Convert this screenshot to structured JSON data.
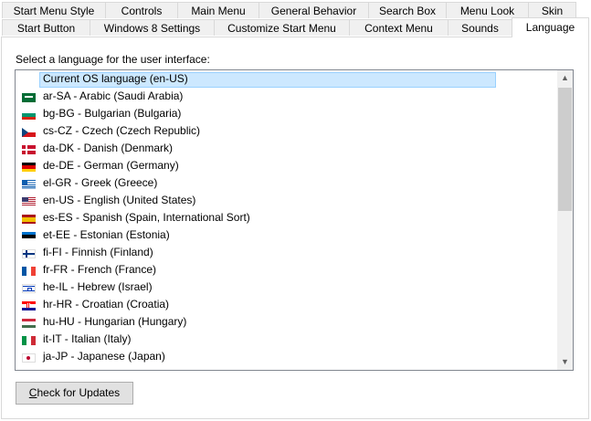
{
  "tabs_row1": [
    {
      "label": "Start Menu Style"
    },
    {
      "label": "Controls"
    },
    {
      "label": "Main Menu"
    },
    {
      "label": "General Behavior"
    },
    {
      "label": "Search Box"
    },
    {
      "label": "Menu Look"
    },
    {
      "label": "Skin"
    }
  ],
  "tabs_row2": [
    {
      "label": "Start Button"
    },
    {
      "label": "Windows 8 Settings"
    },
    {
      "label": "Customize Start Menu"
    },
    {
      "label": "Context Menu"
    },
    {
      "label": "Sounds"
    },
    {
      "label": "Language",
      "selected": true
    }
  ],
  "language_panel": {
    "prompt": "Select a language for the user interface:",
    "selected_index": 0,
    "items": [
      {
        "label": "Current OS language (en-US)",
        "flag": "none"
      },
      {
        "label": "ar-SA - Arabic (Saudi Arabia)",
        "flag": "sa"
      },
      {
        "label": "bg-BG - Bulgarian (Bulgaria)",
        "flag": "bg"
      },
      {
        "label": "cs-CZ - Czech (Czech Republic)",
        "flag": "cz"
      },
      {
        "label": "da-DK - Danish (Denmark)",
        "flag": "dk"
      },
      {
        "label": "de-DE - German (Germany)",
        "flag": "de"
      },
      {
        "label": "el-GR - Greek (Greece)",
        "flag": "gr"
      },
      {
        "label": "en-US - English (United States)",
        "flag": "us"
      },
      {
        "label": "es-ES - Spanish (Spain, International Sort)",
        "flag": "es"
      },
      {
        "label": "et-EE - Estonian (Estonia)",
        "flag": "ee"
      },
      {
        "label": "fi-FI - Finnish (Finland)",
        "flag": "fi"
      },
      {
        "label": "fr-FR - French (France)",
        "flag": "fr"
      },
      {
        "label": "he-IL - Hebrew (Israel)",
        "flag": "il"
      },
      {
        "label": "hr-HR - Croatian (Croatia)",
        "flag": "hr"
      },
      {
        "label": "hu-HU - Hungarian (Hungary)",
        "flag": "hu"
      },
      {
        "label": "it-IT - Italian (Italy)",
        "flag": "it"
      },
      {
        "label": "ja-JP - Japanese (Japan)",
        "flag": "jp"
      }
    ],
    "check_updates_label": "Check for Updates"
  },
  "icons": {
    "scroll_up": "scroll-up-arrow-icon",
    "scroll_down": "scroll-down-arrow-icon"
  },
  "colors": {
    "selection_fill": "#cce8ff",
    "selection_border": "#99d1ff",
    "tab_background": "#f0f0f0"
  }
}
